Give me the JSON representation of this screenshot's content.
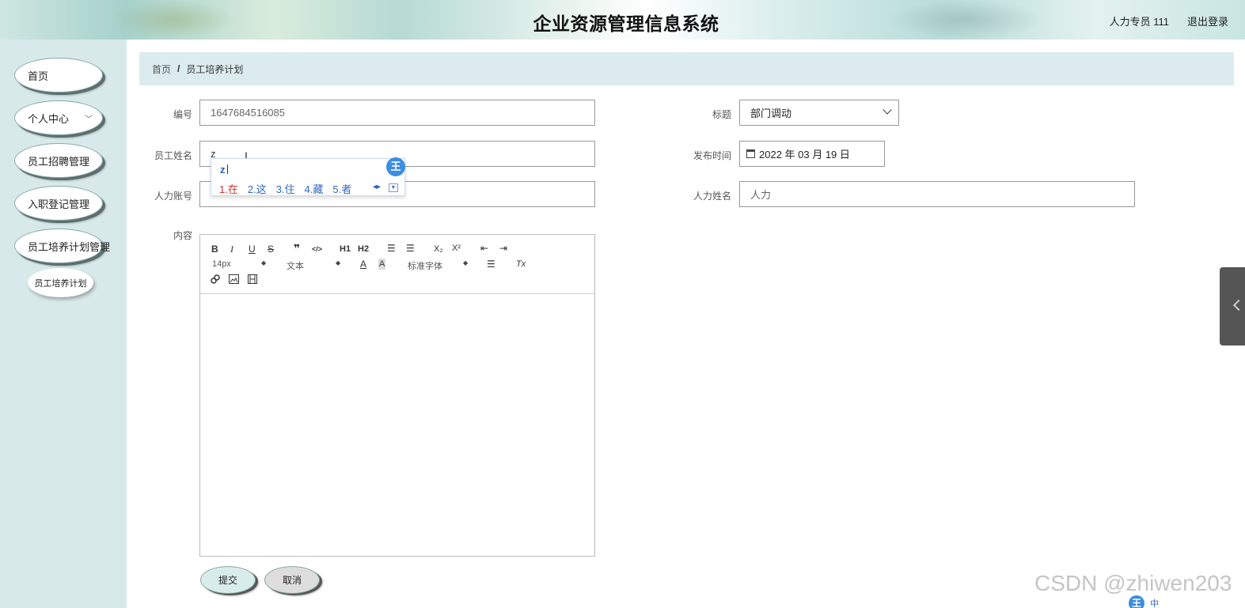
{
  "header": {
    "title": "企业资源管理信息系统",
    "user": "人力专员 111",
    "logout": "退出登录"
  },
  "sidebar": {
    "items": [
      {
        "label": "首页"
      },
      {
        "label": "个人中心"
      },
      {
        "label": "员工招聘管理"
      },
      {
        "label": "入职登记管理"
      },
      {
        "label": "员工培养计划管理"
      }
    ],
    "subitem": "员工培养计划"
  },
  "breadcrumb": {
    "home": "首页",
    "separator": "/",
    "current": "员工培养计划"
  },
  "form": {
    "id_label": "编号",
    "id_value": "1647684516085",
    "title_label": "标题",
    "title_value": "部门调动",
    "name_label": "员工姓名",
    "name_value": "z",
    "publish_label": "发布时间",
    "publish_value": "2022 年 03 月 19 日",
    "account_label": "人力账号",
    "hr_name_label": "人力姓名",
    "hr_name_value": "人力",
    "content_label": "内容"
  },
  "ime": {
    "composition": "z",
    "candidates": [
      "1.在",
      "2.这",
      "3.住",
      "4.藏",
      "5.者"
    ],
    "logo": "王"
  },
  "editor": {
    "toolbar": {
      "bold": "B",
      "italic": "I",
      "underline": "U",
      "strike": "S",
      "blockquote": "❞",
      "code": "</>",
      "h1": "H1",
      "h2": "H2",
      "ordered_list": "☰",
      "bullet_list": "☰",
      "sub": "X₂",
      "sup": "X²",
      "outdent": "⇤",
      "indent": "⇥",
      "size": "14px",
      "header": "文本",
      "font": "标准字体",
      "color": "A",
      "background": "A",
      "align": "☰",
      "clean": "Tx"
    }
  },
  "buttons": {
    "submit": "提交",
    "cancel": "取消"
  },
  "watermark": "CSDN @zhiwen203",
  "ime_status": {
    "logo": "王",
    "lang": "中"
  }
}
